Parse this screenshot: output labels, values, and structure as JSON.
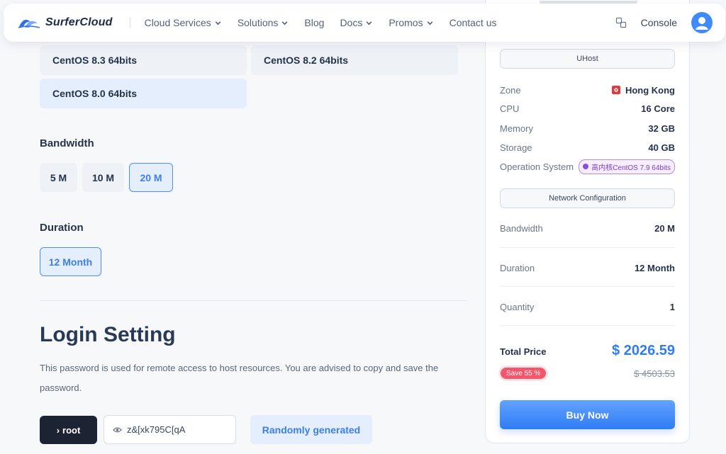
{
  "header": {
    "brand": "SurferCloud",
    "nav": [
      {
        "label": "Cloud Services",
        "has_dropdown": true
      },
      {
        "label": "Solutions",
        "has_dropdown": true
      },
      {
        "label": "Blog",
        "has_dropdown": false
      },
      {
        "label": "Docs",
        "has_dropdown": true
      },
      {
        "label": "Promos",
        "has_dropdown": true
      },
      {
        "label": "Contact us",
        "has_dropdown": false
      }
    ],
    "console_label": "Console",
    "icons": [
      "logo-icon",
      "translate-icon",
      "user-avatar-icon"
    ]
  },
  "main": {
    "os_options": [
      {
        "label": "CentOS 8.3 64bits",
        "selected": false
      },
      {
        "label": "CentOS 8.2 64bits",
        "selected": false
      },
      {
        "label": "CentOS 8.0 64bits",
        "selected": true
      }
    ],
    "bandwidth": {
      "title": "Bandwidth",
      "options": [
        {
          "label": "5 M",
          "selected": false
        },
        {
          "label": "10 M",
          "selected": false
        },
        {
          "label": "20 M",
          "selected": true
        }
      ]
    },
    "duration": {
      "title": "Duration",
      "options": [
        {
          "label": "12 Month",
          "selected": true
        }
      ]
    },
    "login": {
      "title": "Login Setting",
      "description": "This password is used for remote access to host resources. You are advised to copy and save the password.",
      "user_button": "root",
      "password_value": "z&[xk795C[qA",
      "random_button": "Randomly generated"
    }
  },
  "summary": {
    "section_uhost": "UHost",
    "specs": [
      {
        "key": "Zone",
        "value": "Hong Kong"
      },
      {
        "key": "CPU",
        "value": "16 Core"
      },
      {
        "key": "Memory",
        "value": "32 GB"
      },
      {
        "key": "Storage",
        "value": "40 GB"
      },
      {
        "key": "Operation System",
        "value": "高内核CentOS 7.9 64bits"
      }
    ],
    "section_network": "Network Configuration",
    "network": [
      {
        "key": "Bandwidth",
        "value": "20 M"
      },
      {
        "key": "Duration",
        "value": "12 Month"
      },
      {
        "key": "Quantity",
        "value": "1"
      }
    ],
    "total_label": "Total Price",
    "total_price": "$ 2026.59",
    "save_badge": "Save 55 %",
    "original_price": "$ 4503.53",
    "buy_button": "Buy Now"
  },
  "colors": {
    "accent": "#2f7cf6",
    "selected_bg": "#e4eefc",
    "selected_border": "#4d8ef3",
    "save_badge": "#f4566c",
    "os_badge": "#7a3dc7"
  }
}
